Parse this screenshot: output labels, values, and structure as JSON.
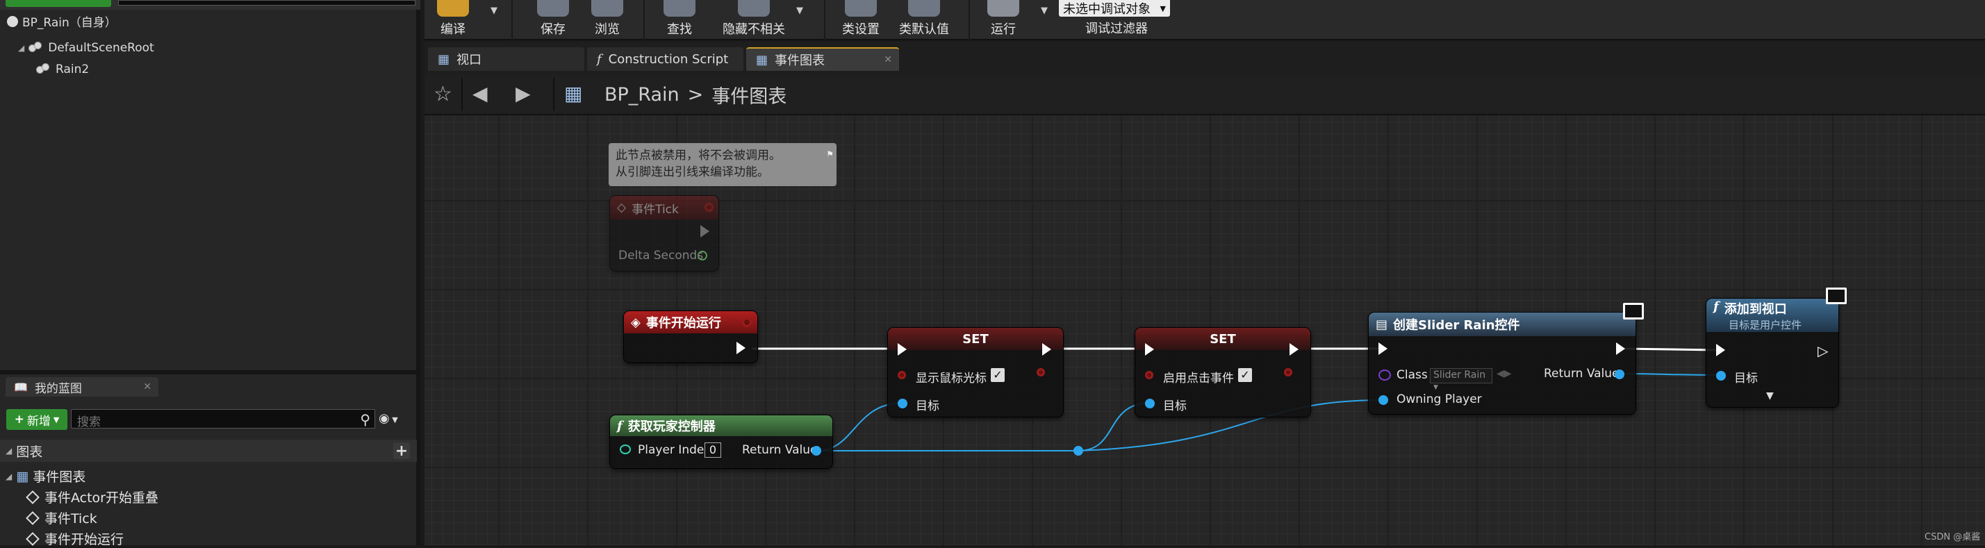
{
  "components": {
    "root_label": "BP_Rain（自身）",
    "tree": [
      {
        "label": "DefaultSceneRoot"
      },
      {
        "label": "Rain2"
      }
    ]
  },
  "my_blueprint": {
    "tab_label": "我的蓝图",
    "new_button": "新增",
    "search_placeholder": "搜索",
    "graphs_header": "图表",
    "event_graph": "事件图表",
    "events": [
      "事件Actor开始重叠",
      "事件Tick",
      "事件开始运行"
    ]
  },
  "toolbar": {
    "compile": "编译",
    "save": "保存",
    "browse": "浏览",
    "find": "查找",
    "hide_unrelated": "隐藏不相关",
    "class_settings": "类设置",
    "class_defaults": "类默认值",
    "run": "运行",
    "debug_object": "未选中调试对象",
    "debug_filter": "调试过滤器"
  },
  "tabs": [
    {
      "label": "视口"
    },
    {
      "label": "Construction Script"
    },
    {
      "label": "事件图表"
    }
  ],
  "breadcrumb": {
    "blueprint": "BP_Rain",
    "separator": ">",
    "graph": "事件图表"
  },
  "graph": {
    "comment_text": [
      "此节点被禁用，将不会被调用。",
      "从引脚连出引线来编译功能。"
    ],
    "node_tick": {
      "title": "事件Tick",
      "pin": "Delta Seconds"
    },
    "node_begin": {
      "title": "事件开始运行"
    },
    "node_get_pc": {
      "title": "获取玩家控制器",
      "player_index_label": "Player Index",
      "player_index_value": "0",
      "return": "Return Value"
    },
    "node_set1": {
      "title": "SET",
      "var": "显示鼠标光标",
      "target": "目标"
    },
    "node_set2": {
      "title": "SET",
      "var": "启用点击事件",
      "target": "目标"
    },
    "node_create": {
      "title": "创建Slider Rain控件",
      "class_label": "Class",
      "class_value": "Slider Rain",
      "return": "Return Value",
      "owner": "Owning Player"
    },
    "node_add": {
      "title": "添加到视口",
      "subtitle": "目标是用户控件",
      "target": "目标"
    }
  },
  "watermark": "CSDN @桌酱"
}
